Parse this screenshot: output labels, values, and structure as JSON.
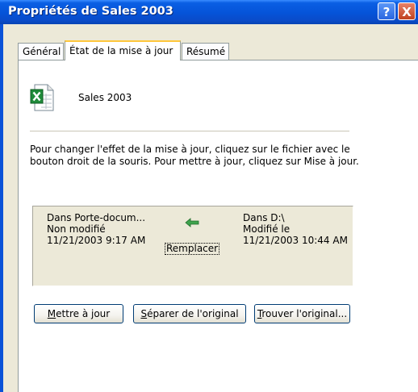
{
  "window": {
    "title": "Propriétés de Sales 2003",
    "help_glyph": "?",
    "close_glyph": "X"
  },
  "tabs": [
    {
      "label": "Général",
      "active": false
    },
    {
      "label": "État de la mise à jour",
      "active": true
    },
    {
      "label": "Résumé",
      "active": false
    }
  ],
  "file": {
    "name": "Sales 2003",
    "icon": "excel-workbook-icon"
  },
  "description": "Pour changer l'effet de la mise à jour, cliquez sur le fichier avec le bouton droit de la souris. Pour mettre à jour, cliquez sur Mise à jour.",
  "sync": {
    "left": {
      "location": "Dans Porte-docum...",
      "status": "Non modifié",
      "datetime": "11/21/2003 9:17 AM"
    },
    "right": {
      "location": "Dans D:\\",
      "status": "Modifié le",
      "datetime": "11/21/2003 10:44 AM"
    },
    "action": "Remplacer",
    "arrow_icon": "left-arrow-icon",
    "arrow_color": "#2e8b3a"
  },
  "buttons": {
    "update": {
      "accel": "M",
      "rest": "ettre à jour"
    },
    "separate": {
      "accel": "S",
      "rest": "éparer de l'original"
    },
    "find": {
      "accel": "T",
      "rest": "rouver l'original..."
    }
  },
  "colors": {
    "titlebar": "#0553d8",
    "dialog_bg": "#ece9d8",
    "active_tab_accent": "#ffc73c"
  }
}
